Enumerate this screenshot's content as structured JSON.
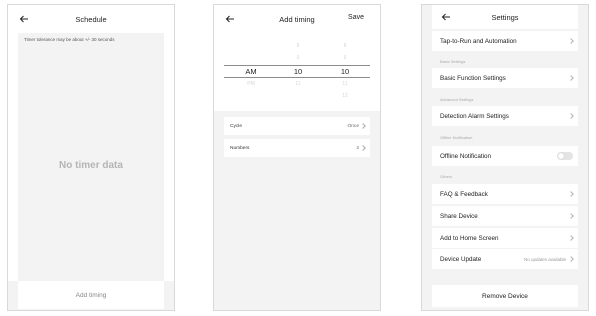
{
  "schedule": {
    "title": "Schedule",
    "tolerance_note": "Timer tolerance may be about +/- 30 seconds",
    "empty_text": "No timer data",
    "add_timing_label": "Add timing"
  },
  "add_timing": {
    "title": "Add timing",
    "save_label": "Save",
    "ampm": [
      "AM",
      "PM"
    ],
    "ampm_selected": "AM",
    "hours": [
      "8",
      "9",
      "10",
      "11"
    ],
    "hour_selected": "10",
    "minutes": [
      "8",
      "9",
      "10",
      "11",
      "12"
    ],
    "minute_selected": "10",
    "cycle": {
      "label": "Cycle",
      "value": "Once"
    },
    "numbers": {
      "label": "Numbers",
      "value": "2"
    }
  },
  "settings": {
    "title": "Settings",
    "tap_to_run": "Tap-to-Run and Automation",
    "section_basic": "Basic Settings",
    "basic_function": "Basic Function Settings",
    "section_advanced": "Advanced Settings",
    "detection_alarm": "Detection Alarm Settings",
    "section_offline": "Offline Notification",
    "offline_notification": "Offline Notification",
    "offline_enabled": false,
    "section_others": "Others",
    "faq": "FAQ & Feedback",
    "share": "Share Device",
    "add_home": "Add to Home Screen",
    "device_update": "Device Update",
    "device_update_status": "No updates available",
    "remove_device": "Remove Device"
  },
  "colors": {
    "background": "#f3f3f3",
    "card": "#ffffff",
    "muted_text": "#b5b5b5"
  }
}
